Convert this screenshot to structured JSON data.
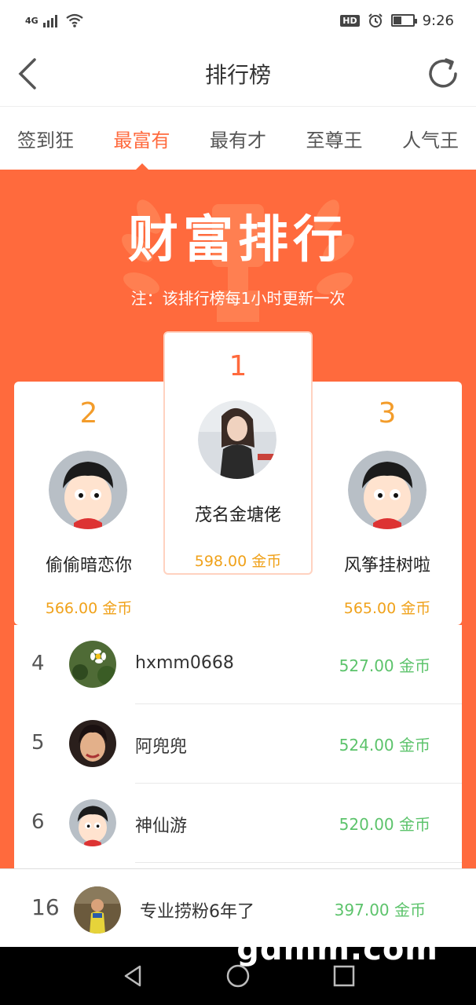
{
  "status_bar": {
    "network": "4G",
    "time": "9:26",
    "hd": "HD",
    "battery_level": 0.4
  },
  "header": {
    "title": "排行榜"
  },
  "tabs": [
    {
      "label": "签到狂",
      "active": false
    },
    {
      "label": "最富有",
      "active": true
    },
    {
      "label": "最有才",
      "active": false
    },
    {
      "label": "至尊王",
      "active": false
    },
    {
      "label": "人气王",
      "active": false
    }
  ],
  "hero": {
    "title": "财富排行",
    "note": "注：该排行榜每1小时更新一次"
  },
  "podium": {
    "first": {
      "rank": "1",
      "name": "茂名金塘佬",
      "amount": "598.00  金币"
    },
    "second": {
      "rank": "2",
      "name": "偷偷暗恋你",
      "amount": "566.00  金币"
    },
    "third": {
      "rank": "3",
      "name": "风筝挂树啦",
      "amount": "565.00  金币"
    }
  },
  "list": [
    {
      "rank": "4",
      "name": "hxmm0668",
      "amount": "527.00 金币",
      "avatar": "flower-photo"
    },
    {
      "rank": "5",
      "name": "阿兜兜",
      "amount": "524.00 金币",
      "avatar": "woman-photo"
    },
    {
      "rank": "6",
      "name": "神仙游",
      "amount": "520.00 金币",
      "avatar": "cartoon-boy"
    }
  ],
  "self": {
    "rank": "16",
    "name": "专业捞粉6年了",
    "amount": "397.00 金币"
  },
  "watermark": "gdmm.com",
  "colors": {
    "accent": "#ff6a3d",
    "gold": "#f0a21b",
    "green": "#5cc36b"
  }
}
